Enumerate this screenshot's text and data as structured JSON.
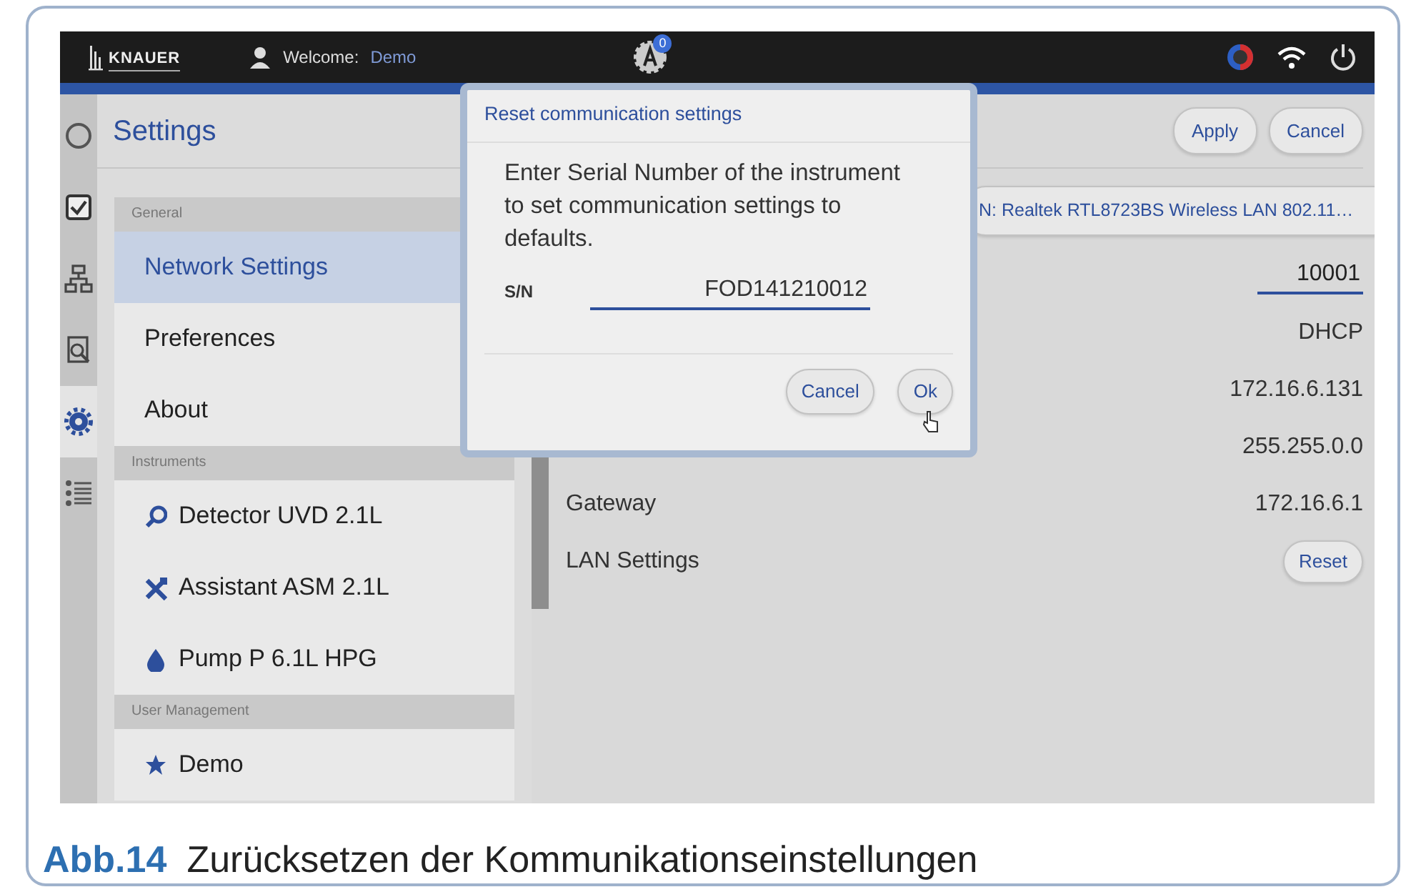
{
  "topbar": {
    "logo": "KNAUER",
    "welcome_label": "Welcome:",
    "user": "Demo",
    "badge_count": "0"
  },
  "rail": [
    {
      "kind": "status",
      "selected": false
    },
    {
      "kind": "checklist",
      "selected": false
    },
    {
      "kind": "network",
      "selected": false
    },
    {
      "kind": "inspect",
      "selected": false
    },
    {
      "kind": "settings",
      "selected": true
    },
    {
      "kind": "methods",
      "selected": false
    }
  ],
  "settings": {
    "title": "Settings",
    "sections": [
      {
        "heading": "General",
        "items": [
          {
            "label": "Network Settings",
            "selected": true
          },
          {
            "label": "Preferences",
            "selected": false
          },
          {
            "label": "About",
            "selected": false
          }
        ]
      },
      {
        "heading": "Instruments",
        "items": [
          {
            "label": "Detector UVD 2.1L",
            "kind": "detector",
            "selected": false
          },
          {
            "label": "Assistant ASM 2.1L",
            "kind": "assistant",
            "selected": false
          },
          {
            "label": "Pump P 6.1L HPG",
            "kind": "pump",
            "selected": false
          }
        ]
      },
      {
        "heading": "User Management",
        "items": [
          {
            "label": "Demo",
            "kind": "user",
            "selected": false
          }
        ]
      }
    ]
  },
  "content": {
    "buttons": [
      "Apply",
      "Cancel"
    ],
    "adapter": "N: Realtek RTL8723BS Wireless LAN 802.11…",
    "rows": [
      {
        "kind": "input",
        "value": "10001"
      },
      {
        "kind": "text",
        "value": "DHCP"
      },
      {
        "kind": "text",
        "value": "172.16.6.131"
      },
      {
        "kind": "text",
        "value": "255.255.0.0"
      },
      {
        "kind": "text",
        "label": "Gateway",
        "value": "172.16.6.1"
      },
      {
        "kind": "button",
        "label": "LAN Settings",
        "value": "Reset"
      }
    ]
  },
  "dialog": {
    "title": "Reset communication settings",
    "message": "Enter Serial Number of the instrument to set communication settings to defaults.",
    "field_label": "S/N",
    "value": "FOD141210012",
    "buttons": [
      "Cancel",
      "Ok"
    ]
  },
  "caption": {
    "number": "Abb.14",
    "text": "Zurücksetzen der Kommunikationseinstellungen"
  }
}
